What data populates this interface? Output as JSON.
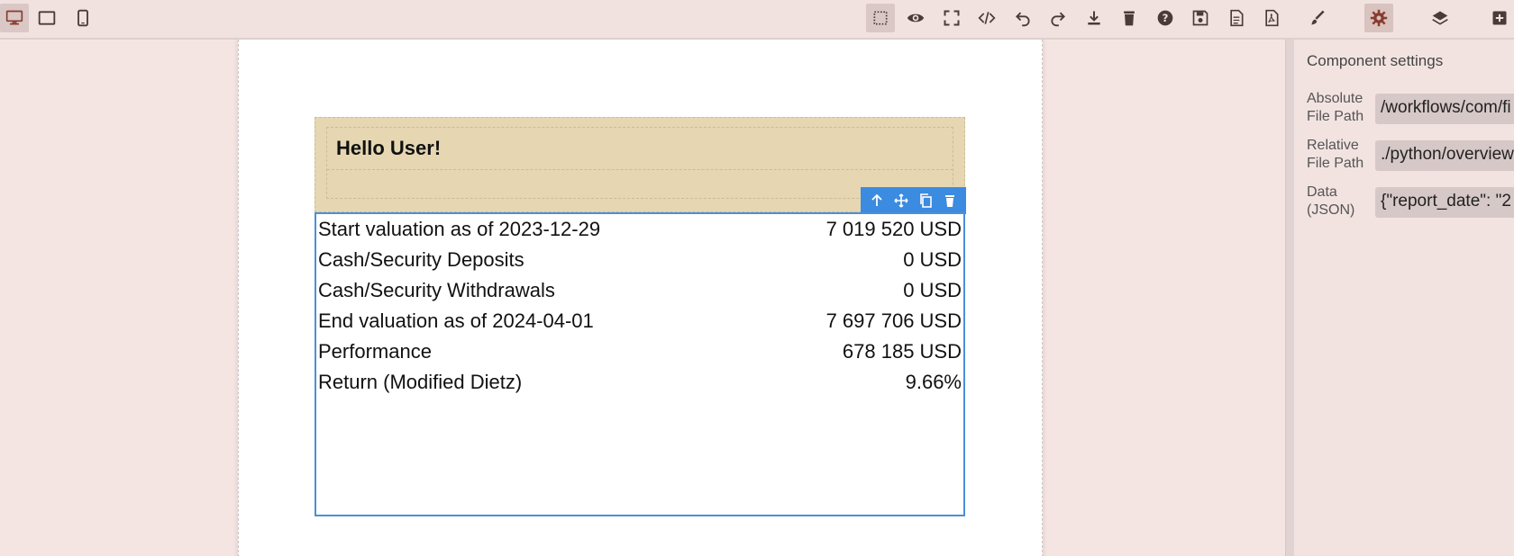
{
  "toolbar": {
    "devices": [
      {
        "icon": "desktop-icon",
        "active": true
      },
      {
        "icon": "tablet-icon",
        "active": false
      },
      {
        "icon": "mobile-icon",
        "active": false
      }
    ],
    "actions": [
      "select-outline-icon",
      "preview-eye-icon",
      "fullscreen-icon",
      "code-icon",
      "undo-icon",
      "redo-icon",
      "download-icon",
      "trash-icon",
      "help-icon",
      "save-icon",
      "document-icon",
      "pdf-icon"
    ],
    "panels": [
      "style-manager-brush-icon",
      "settings-gear-icon",
      "layers-icon",
      "add-blocks-icon"
    ],
    "colors": {
      "accent": "#3b8be0",
      "icon": "#4a3b3b",
      "active_gear": "#8a3b2f"
    }
  },
  "canvas": {
    "header_text": "Hello User!",
    "rows": [
      {
        "label": "Start valuation as of 2023-12-29",
        "value": "7 019 520 USD"
      },
      {
        "label": "Cash/Security Deposits",
        "value": "0 USD"
      },
      {
        "label": "Cash/Security Withdrawals",
        "value": "0 USD"
      },
      {
        "label": "End valuation as of 2024-04-01",
        "value": "7 697 706 USD"
      },
      {
        "label": "Performance",
        "value": "678 185 USD"
      },
      {
        "label": "Return (Modified Dietz)",
        "value": "9.66%"
      }
    ]
  },
  "settings_panel": {
    "title": "Component settings",
    "fields": [
      {
        "label_line1": "Absolute",
        "label_line2": "File Path",
        "value": "/workflows/com/fi"
      },
      {
        "label_line1": "Relative",
        "label_line2": "File Path",
        "value": "./python/overview"
      },
      {
        "label_line1": "Data",
        "label_line2": "(JSON)",
        "value": "{\"report_date\": \"2"
      }
    ]
  }
}
